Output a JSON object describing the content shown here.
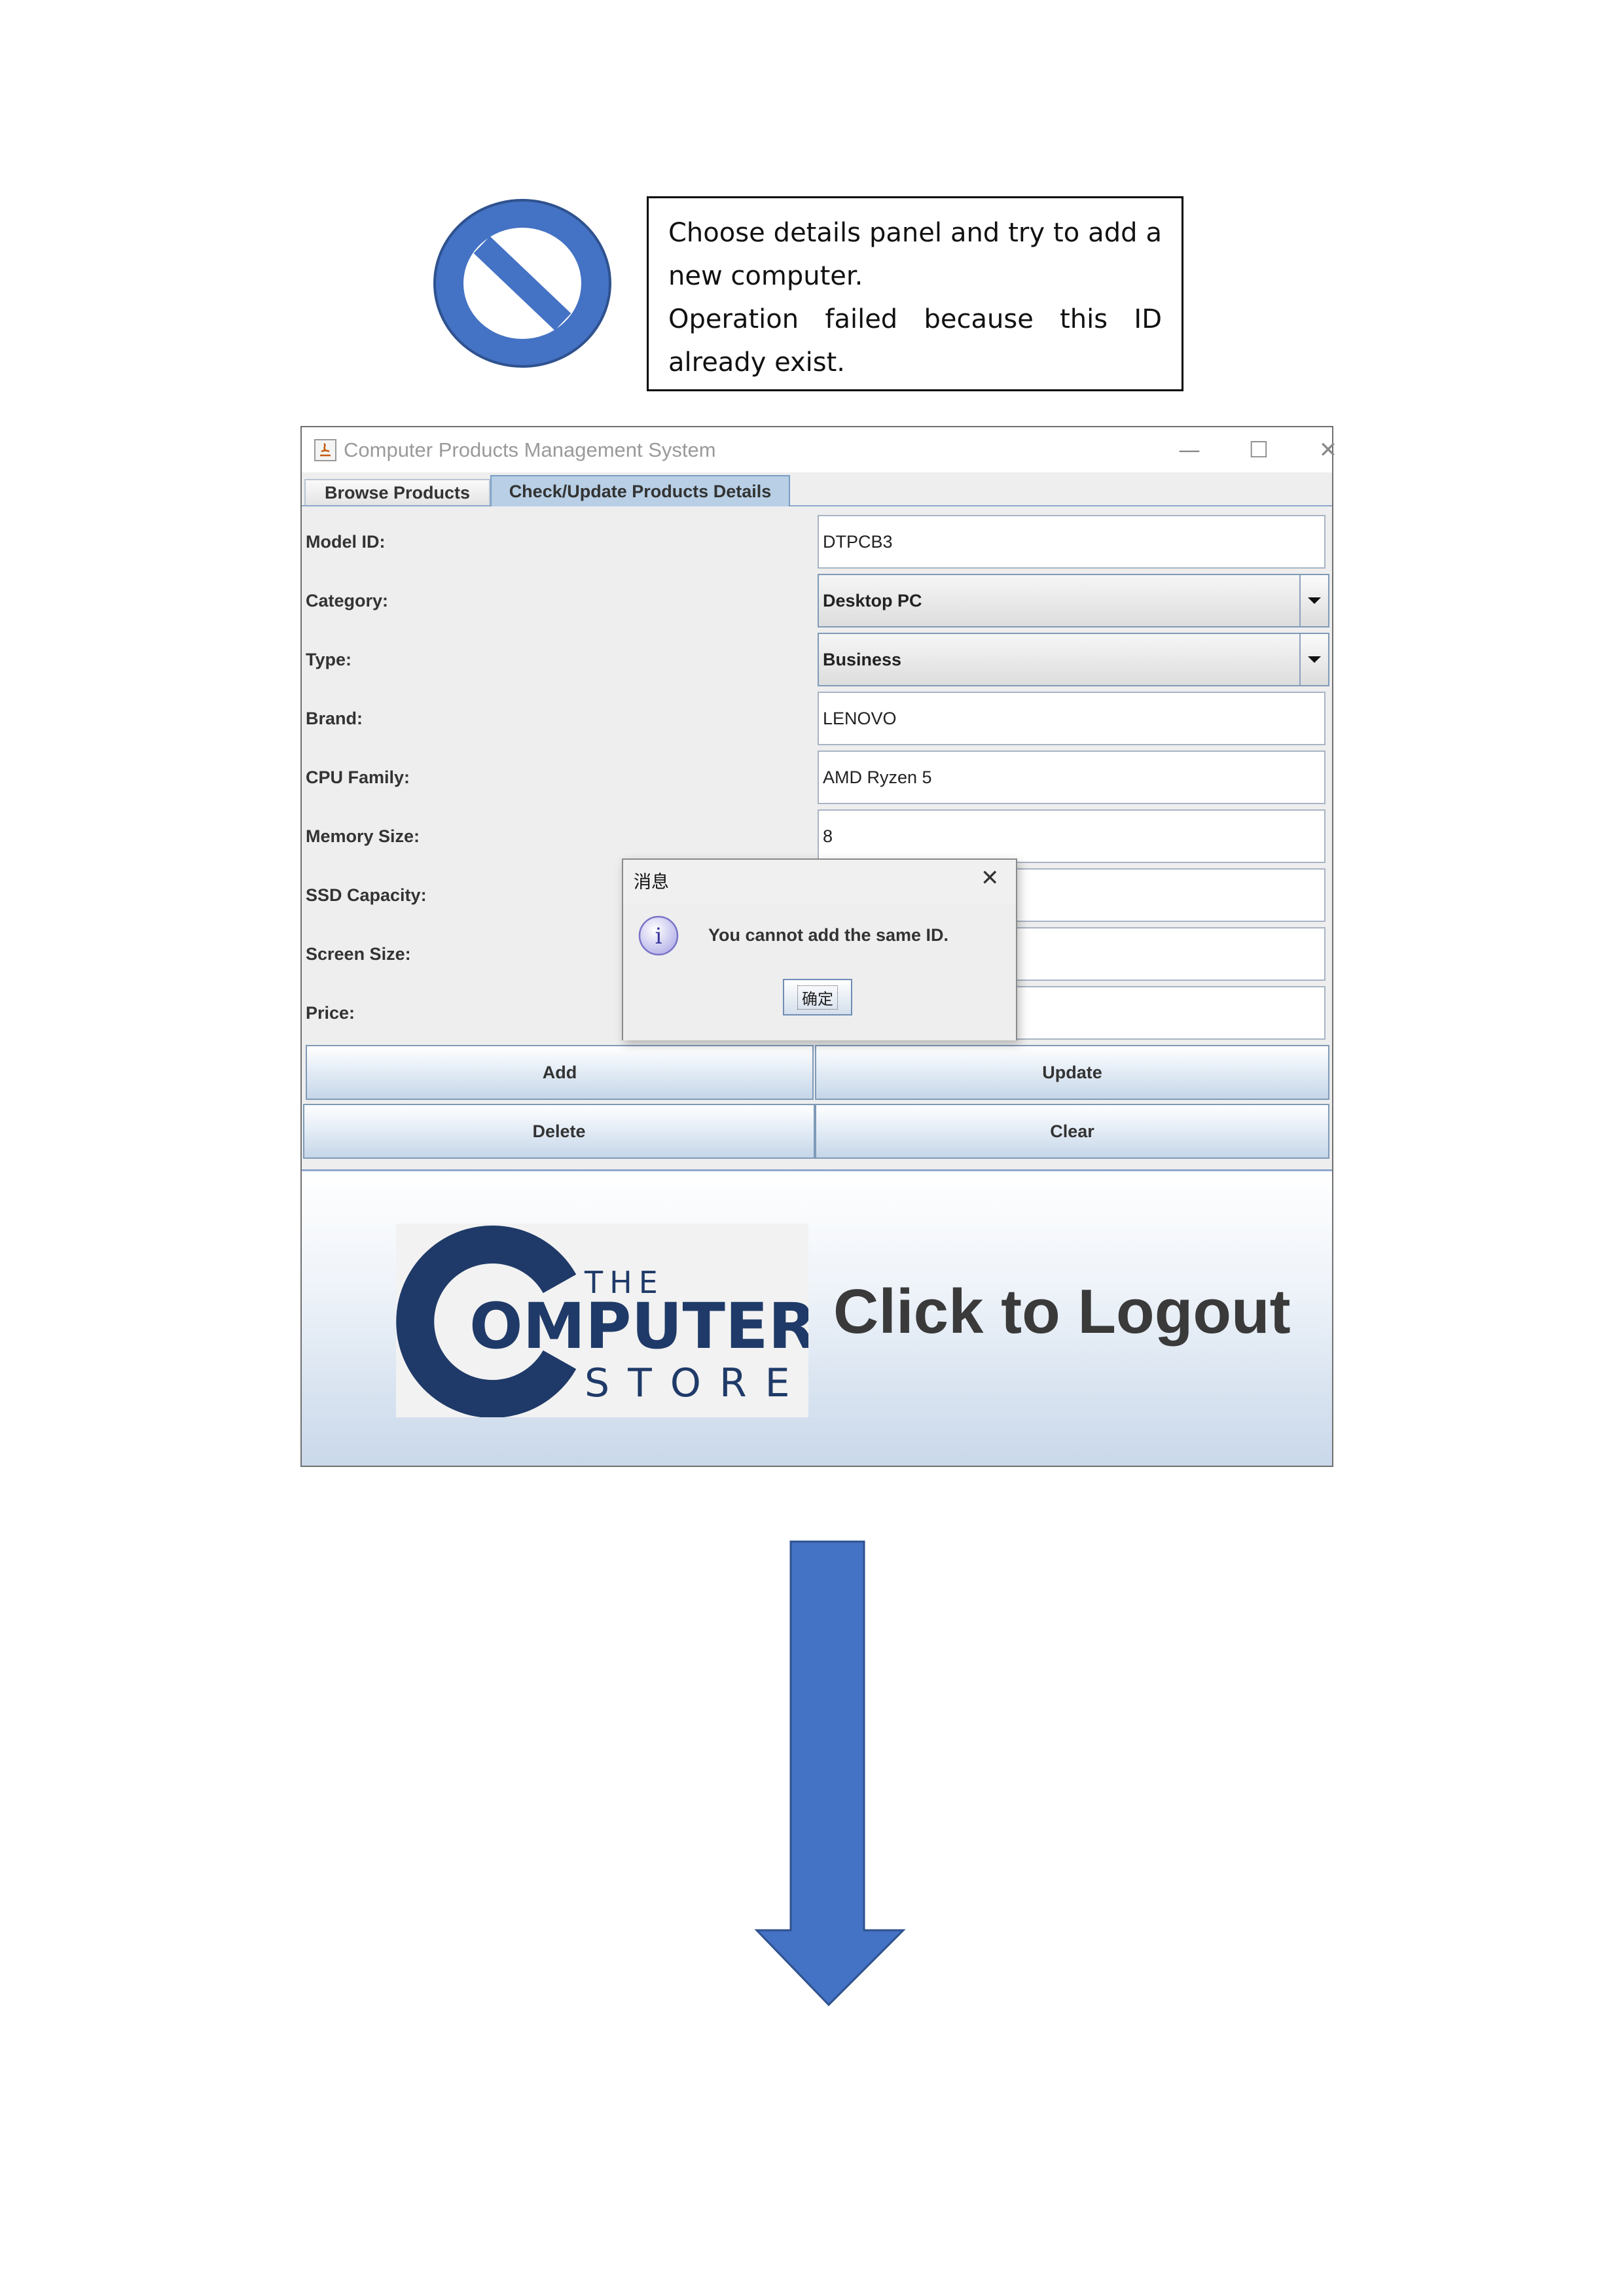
{
  "note": {
    "line1": "Choose details panel and try to add a new computer.",
    "line2": "Operation failed because this ID already exist."
  },
  "window": {
    "title": "Computer Products Management System",
    "controls": {
      "minimize": "—",
      "maximize": "☐",
      "close": "✕"
    }
  },
  "tabs": [
    {
      "label": "Browse Products",
      "selected": false
    },
    {
      "label": "Check/Update Products Details",
      "selected": true
    }
  ],
  "form": {
    "model_id": {
      "label": "Model ID:",
      "value": "DTPCB3"
    },
    "category": {
      "label": "Category:",
      "value": "Desktop PC"
    },
    "type": {
      "label": "Type:",
      "value": "Business"
    },
    "brand": {
      "label": "Brand:",
      "value": "LENOVO"
    },
    "cpu_family": {
      "label": "CPU Family:",
      "value": "AMD Ryzen 5"
    },
    "memory_size": {
      "label": "Memory Size:",
      "value": "8"
    },
    "ssd_capacity": {
      "label": "SSD Capacity:",
      "value": ""
    },
    "screen_size": {
      "label": "Screen Size:",
      "value": ""
    },
    "price": {
      "label": "Price:",
      "value": ""
    }
  },
  "buttons": {
    "add": "Add",
    "update": "Update",
    "delete": "Delete",
    "clear": "Clear"
  },
  "logout": {
    "text": "Click to Logout",
    "logo_text": {
      "the": "THE",
      "computer": "OMPUTER",
      "store": "STORE"
    }
  },
  "dialog": {
    "title": "消息",
    "message": "You cannot add the same ID.",
    "ok_label": "确定"
  },
  "colors": {
    "icon_blue": "#4472c4",
    "logo_navy": "#1f3a68",
    "tab_selected": "#b8cfe5"
  }
}
